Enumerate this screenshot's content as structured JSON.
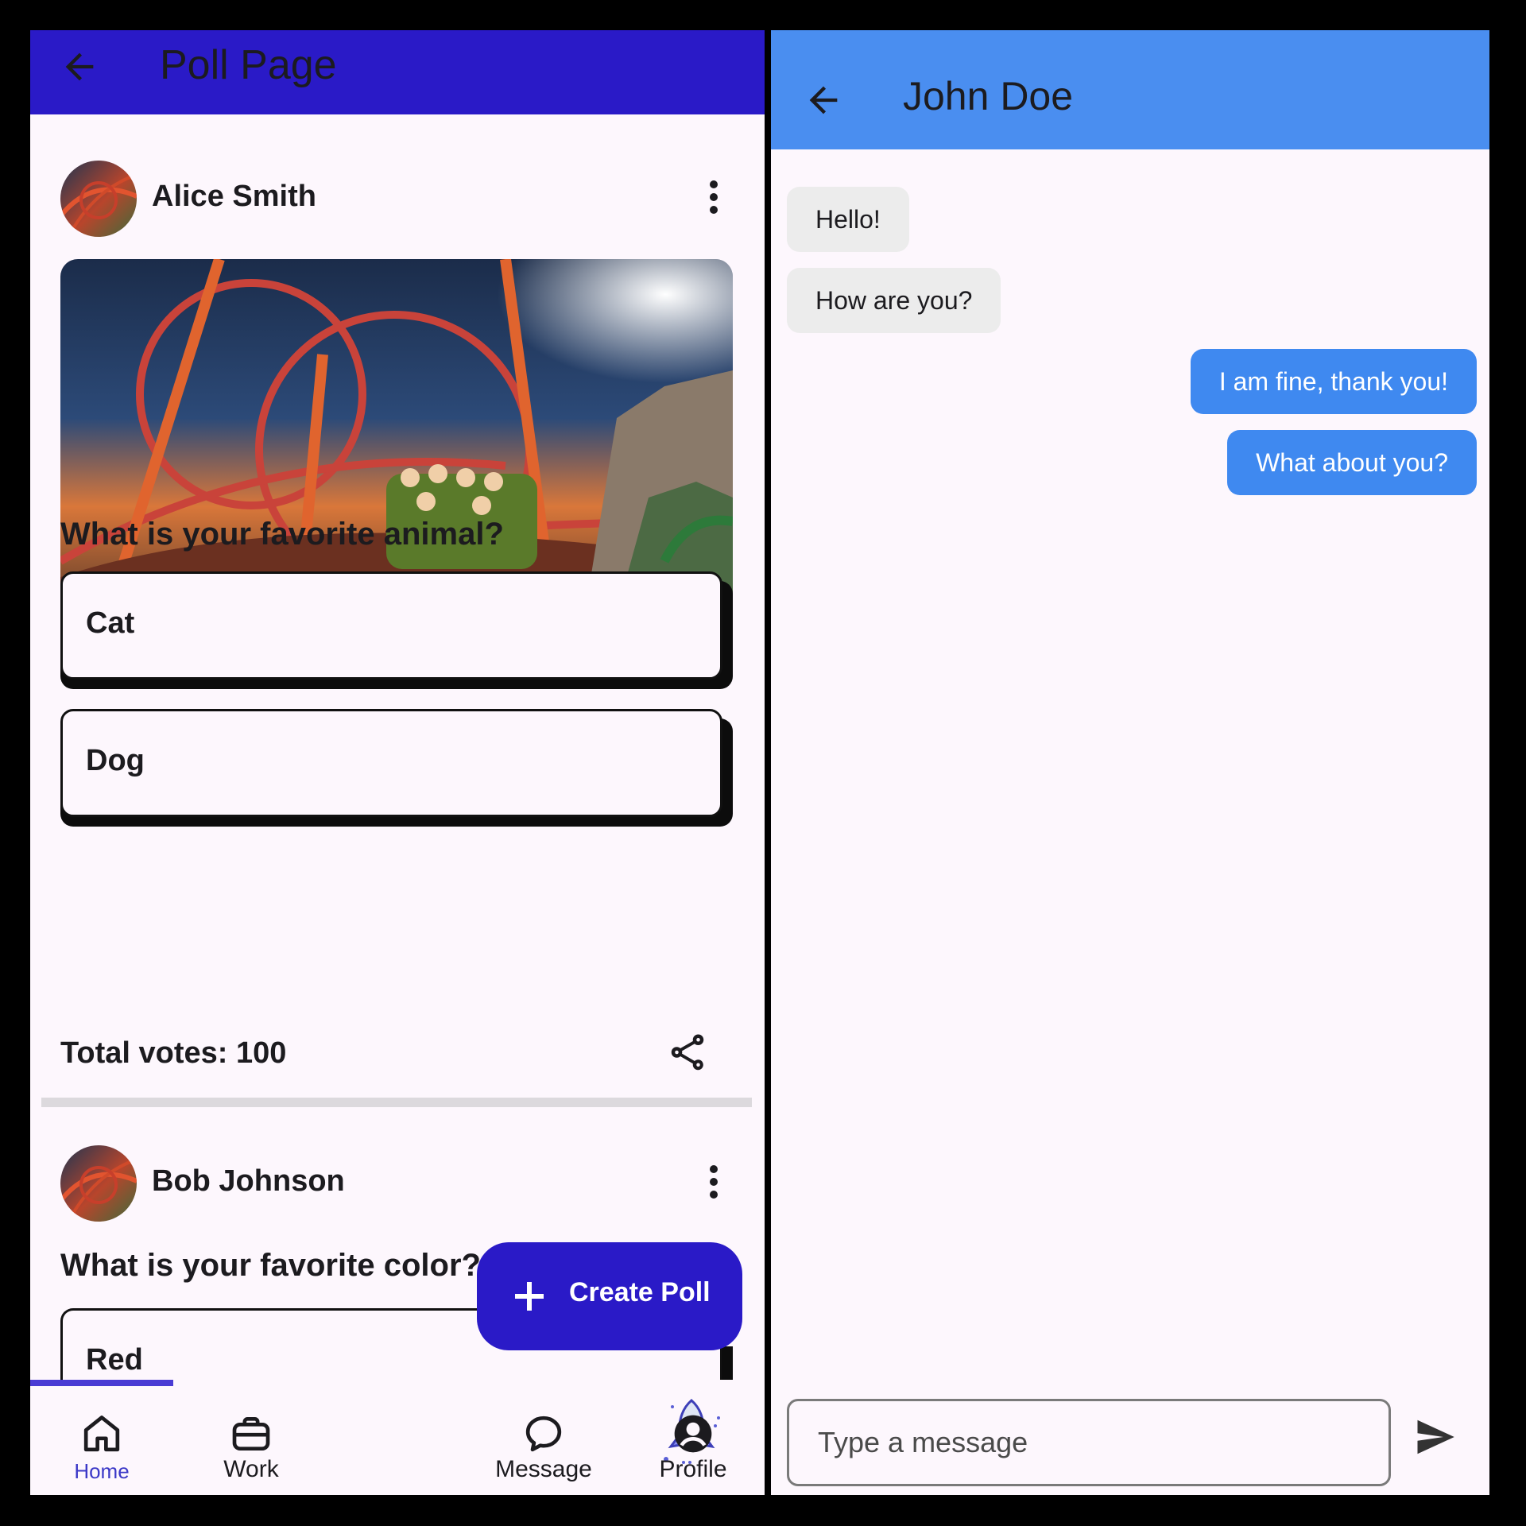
{
  "poll_page": {
    "appbar": {
      "title": "Poll Page",
      "back_icon": "arrow-left-icon",
      "color": "#2a1ac7"
    },
    "posts": [
      {
        "author": "Alice Smith",
        "question": "What is your favorite animal?",
        "options": [
          "Cat",
          "Dog"
        ],
        "total_votes_label": "Total votes: 100"
      },
      {
        "author": "Bob Johnson",
        "question": "What is your favorite color?",
        "options": [
          "Red"
        ]
      }
    ],
    "fab": {
      "label": "Create Poll",
      "icon": "plus-icon"
    },
    "bottom_nav": {
      "items": [
        {
          "label": "Home",
          "icon": "home-icon",
          "active": true
        },
        {
          "label": "Work",
          "icon": "briefcase-icon"
        },
        {
          "label": "",
          "icon": "rocket-icon"
        },
        {
          "label": "Message",
          "icon": "chat-bubble-icon"
        },
        {
          "label": "Profile",
          "icon": "profile-icon"
        }
      ]
    }
  },
  "chat": {
    "appbar": {
      "title": "John Doe",
      "back_icon": "arrow-left-icon",
      "color": "#4a8ef0"
    },
    "messages": [
      {
        "text": "Hello!",
        "direction": "incoming"
      },
      {
        "text": "How are you?",
        "direction": "incoming"
      },
      {
        "text": "I am fine, thank you!",
        "direction": "outgoing"
      },
      {
        "text": "What about you?",
        "direction": "outgoing"
      }
    ],
    "composer": {
      "placeholder": "Type a message",
      "value": "",
      "send_icon": "send-icon"
    }
  }
}
